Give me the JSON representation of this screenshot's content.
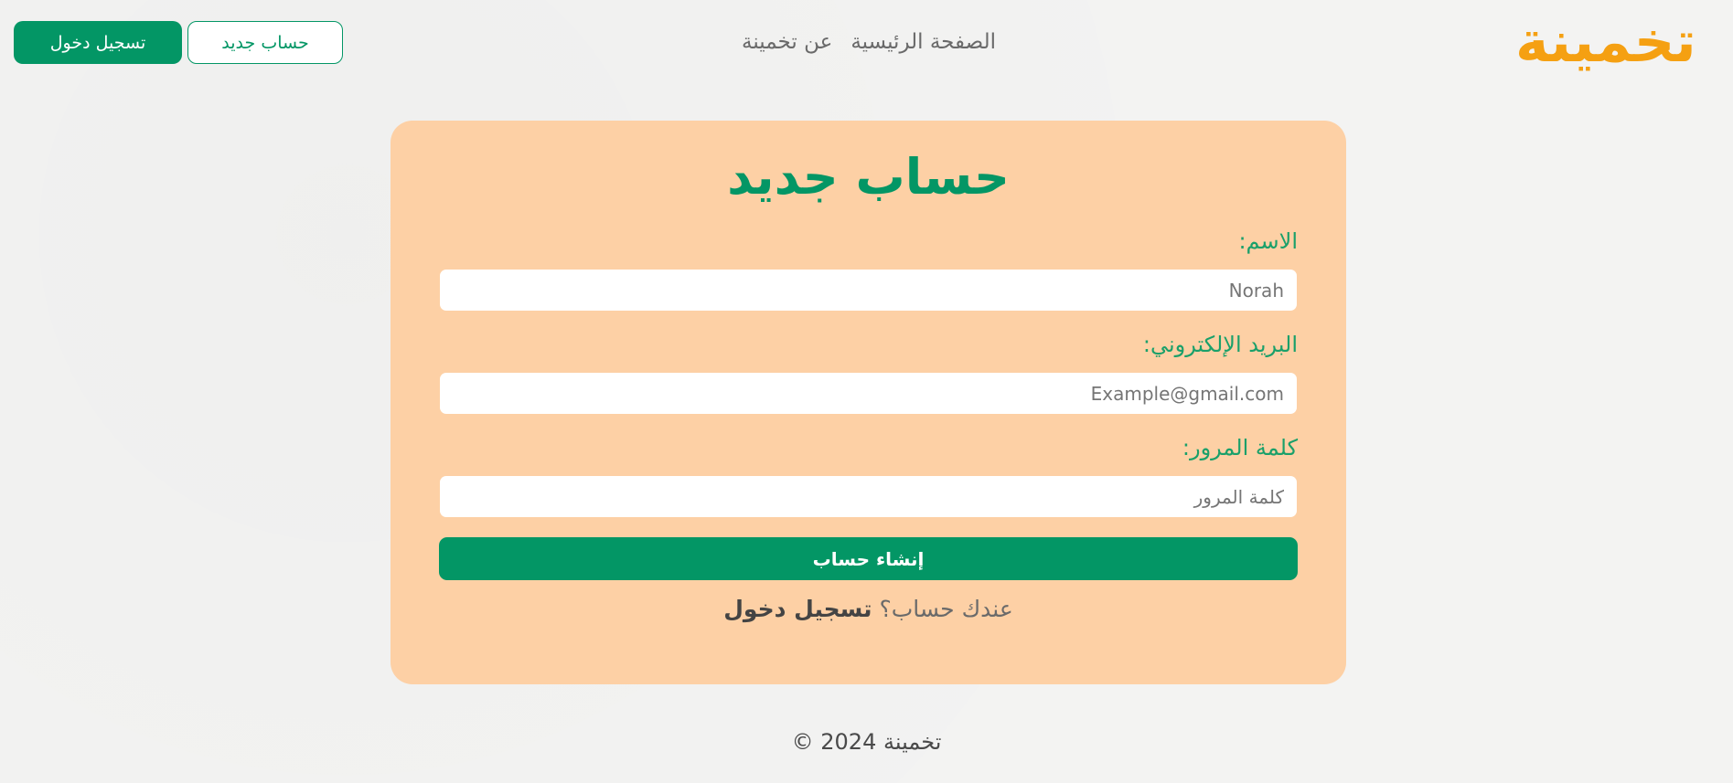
{
  "header": {
    "logo": {
      "part1": "تخمينة"
    },
    "nav": {
      "home": "الصفحة الرئيسية",
      "about": "عن تخمينة"
    },
    "register_button": "حساب جديد",
    "login_button": "تسجيل دخول"
  },
  "form": {
    "title": "حساب جديد",
    "name_label": "الاسم:",
    "name_placeholder": "Norah",
    "email_label": "البريد الإلكتروني:",
    "email_placeholder": "Example@gmail.com",
    "password_label": "كلمة المرور:",
    "password_placeholder": "كلمة المرور",
    "submit_label": "إنشاء حساب",
    "have_account_text": "عندك حساب؟",
    "login_link": "تسجيل دخول"
  },
  "footer": {
    "copyright": "تخمينة 2024 ©"
  },
  "colors": {
    "primary_green": "#039665",
    "card_bg": "#fdd0a5",
    "logo_orange": "#f5a012"
  }
}
